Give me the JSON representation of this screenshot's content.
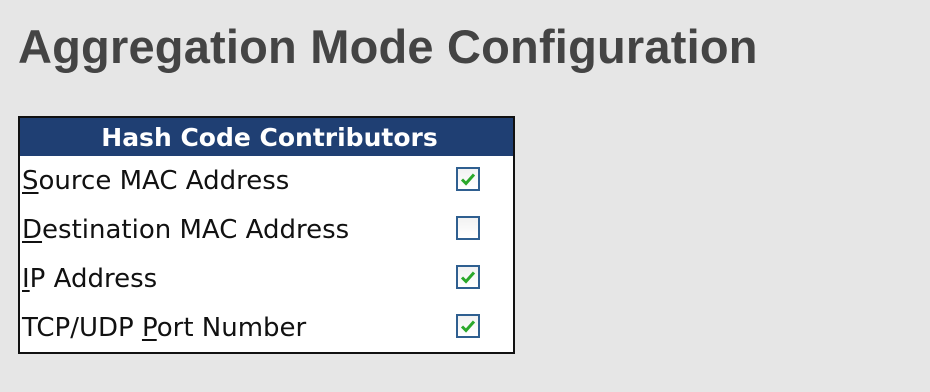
{
  "page": {
    "title": "Aggregation Mode Configuration"
  },
  "table": {
    "header": "Hash Code Contributors",
    "rows": [
      {
        "access_key": "S",
        "label_rest": "ource MAC Address",
        "checked": true
      },
      {
        "access_key": "D",
        "label_rest": "estination MAC Address",
        "checked": false
      },
      {
        "access_key": "I",
        "label_rest": "P Address",
        "checked": true
      },
      {
        "label_prefix": "TCP/UDP ",
        "access_key": "P",
        "label_rest": "ort Number",
        "checked": true
      }
    ]
  },
  "colors": {
    "header_bg": "#1f3f73",
    "checkmark": "#2aa82a",
    "page_bg": "#e6e6e6"
  }
}
